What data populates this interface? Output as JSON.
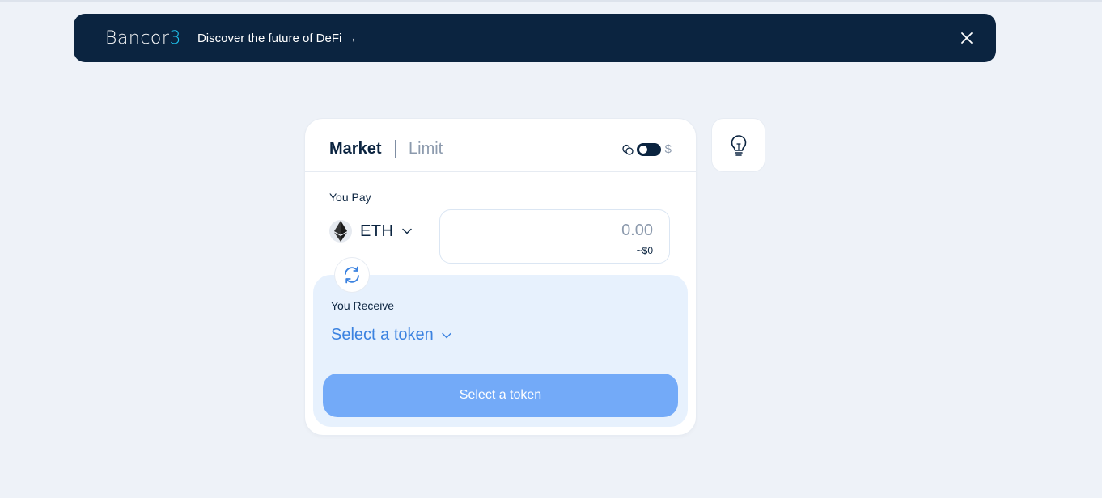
{
  "banner": {
    "logo_text": "Bancor",
    "logo_suffix": "3",
    "message": "Discover the future of DeFi →",
    "close_icon": "close-icon"
  },
  "swap": {
    "tabs": [
      {
        "label": "Market",
        "active": true
      },
      {
        "label": "Limit",
        "active": false
      }
    ],
    "currency_toggle": {
      "token_icon": "coins-icon",
      "dollar_label": "$",
      "usd_mode": false
    },
    "pay": {
      "label": "You Pay",
      "token": "ETH",
      "token_icon": "eth-icon",
      "amount_placeholder": "0.00",
      "usd_value": "~$0"
    },
    "switch_icon": "swap-arrows-icon",
    "receive": {
      "label": "You Receive",
      "select_label": "Select a token"
    },
    "cta_label": "Select a token"
  },
  "tips": {
    "icon": "lightbulb-icon"
  },
  "colors": {
    "banner_bg": "#0b2440",
    "accent": "#3b82e0",
    "cta_bg": "#73aaf8",
    "logo_accent": "#1fc5f0"
  }
}
